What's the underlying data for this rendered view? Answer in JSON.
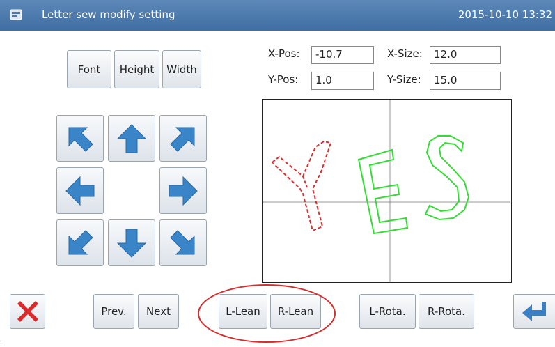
{
  "titlebar": {
    "icon": "app-window-icon",
    "title": "Letter sew modify setting",
    "datetime": "2015-10-10 13:32"
  },
  "mode_buttons": [
    {
      "label": "Font"
    },
    {
      "label": "Height"
    },
    {
      "label": "Width"
    }
  ],
  "fields": {
    "x_pos": {
      "label": "X-Pos:",
      "value": "-10.7"
    },
    "x_size": {
      "label": "X-Size:",
      "value": "12.0"
    },
    "y_pos": {
      "label": "Y-Pos:",
      "value": "1.0"
    },
    "y_size": {
      "label": "Y-Size:",
      "value": "15.0"
    }
  },
  "arrows": [
    {
      "name": "up-left",
      "icon": "arrow-up-left-icon"
    },
    {
      "name": "up",
      "icon": "arrow-up-icon"
    },
    {
      "name": "up-right",
      "icon": "arrow-up-right-icon"
    },
    {
      "name": "left",
      "icon": "arrow-left-icon"
    },
    {
      "name": "right",
      "icon": "arrow-right-icon"
    },
    {
      "name": "down-left",
      "icon": "arrow-down-left-icon"
    },
    {
      "name": "down",
      "icon": "arrow-down-icon"
    },
    {
      "name": "down-right",
      "icon": "arrow-down-right-icon"
    }
  ],
  "preview": {
    "letters": [
      "Y",
      "E",
      "S"
    ],
    "selected_color": "#d93030",
    "normal_color": "#33dd33",
    "crosshair_color": "#999999"
  },
  "bottom": {
    "cancel_icon": "close-x-icon",
    "prev": "Prev.",
    "next": "Next",
    "l_lean": "L-Lean",
    "r_lean": "R-Lean",
    "l_rota": "L-Rota.",
    "r_rota": "R-Rota.",
    "enter_icon": "enter-return-icon"
  },
  "colors": {
    "title_bar": "#4a78ad",
    "highlight_circle": "#d62d2d",
    "cancel_x": "#d92b2b",
    "arrow_blue": "#3a85c8",
    "enter_blue": "#3a7fc4"
  },
  "corner_mark": "'"
}
